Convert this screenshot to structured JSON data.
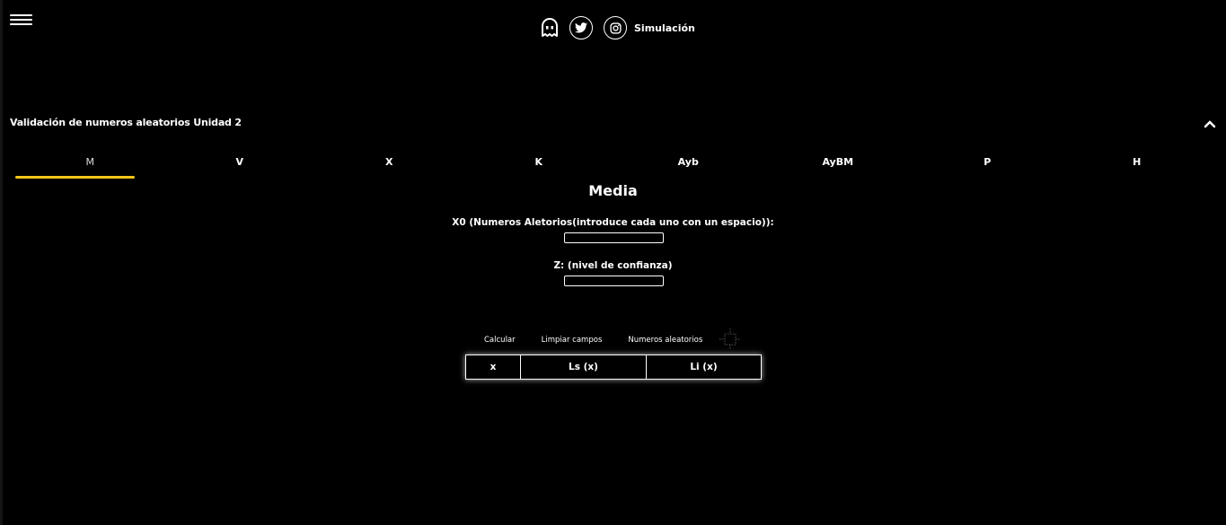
{
  "header": {
    "sim_link_label": "Simulación",
    "icons": [
      "ghost-icon",
      "twitter-icon",
      "instagram-icon"
    ]
  },
  "section": {
    "title": "Validación de numeros aleatorios Unidad 2"
  },
  "tabs": [
    {
      "label": "M",
      "active": true
    },
    {
      "label": "V"
    },
    {
      "label": "X"
    },
    {
      "label": "K"
    },
    {
      "label": "Ayb"
    },
    {
      "label": "AyBM"
    },
    {
      "label": "P"
    },
    {
      "label": "H"
    }
  ],
  "form": {
    "title": "Media",
    "x0_label": "X0 (Numeros Aletorios(introduce cada uno con un espacio)):",
    "x0_value": "",
    "z_label": "Z: (nivel de confianza)",
    "z_value": ""
  },
  "buttons": {
    "calcular": "Calcular",
    "limpiar": "Limpiar campos",
    "aleatorios": "Numeros aleatorios"
  },
  "results_table": {
    "columns": [
      "x",
      "Ls (x)",
      "Li (x)"
    ]
  },
  "colors": {
    "accent": "#f5c518",
    "background": "#000000",
    "text": "#ffffff"
  }
}
